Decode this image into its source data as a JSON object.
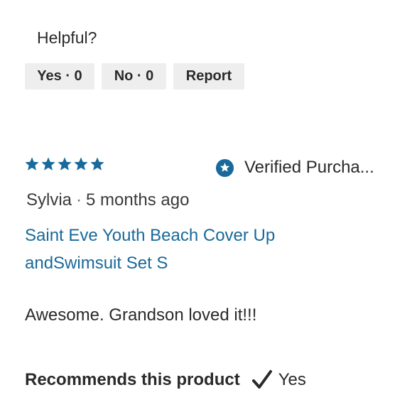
{
  "previous_review": {
    "helpful_label": "Helpful?",
    "yes_button": "Yes · 0",
    "no_button": "No · 0",
    "report_button": "Report"
  },
  "review": {
    "rating": 5,
    "rating_max": 5,
    "star_color": "#19699a",
    "verified_icon": "star-badge-icon",
    "verified_text": "Verified Purcha...",
    "author": "Sylvia",
    "separator": "·",
    "date": "5 months ago",
    "product": "Saint Eve Youth Beach Cover Up andSwimsuit Set S",
    "body": "Awesome. Grandson loved it!!!",
    "recommends_label": "Recommends this product",
    "recommends_icon": "checkmark-icon",
    "recommends_value": "Yes"
  },
  "colors": {
    "link": "#19699a",
    "button_bg": "#eeeeee",
    "text": "#2a2a2a"
  }
}
